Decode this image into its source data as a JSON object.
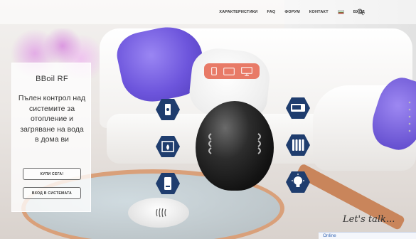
{
  "nav": {
    "items": [
      "ХАРАКТЕРИСТИКИ",
      "FAQ",
      "ФОРУМ",
      "КОНТАКТ"
    ],
    "login": "ВХОД",
    "flag": "bulgaria-flag-icon",
    "search_icon": "search-icon"
  },
  "promo": {
    "title": "BBoil RF",
    "text": "Пълен контрол над системите за отопление и загряване на вода в дома ви",
    "buy_button": "КУПИ СЕГА!",
    "login_button": "ВХОД В СИСТЕМАТА"
  },
  "device_selector": {
    "icons": [
      "phone-icon",
      "tablet-icon",
      "desktop-icon"
    ],
    "accent": "#e87a67"
  },
  "feature_icons": [
    "wall-switch-icon",
    "fireplace-icon",
    "water-heater-icon",
    "ac-unit-icon",
    "radiator-icon",
    "light-bulb-icon"
  ],
  "colors": {
    "hex_fill": "#1f3d6e",
    "accent": "#e87a67"
  },
  "chat": {
    "sign": "Let's talk...",
    "status": "Online"
  }
}
